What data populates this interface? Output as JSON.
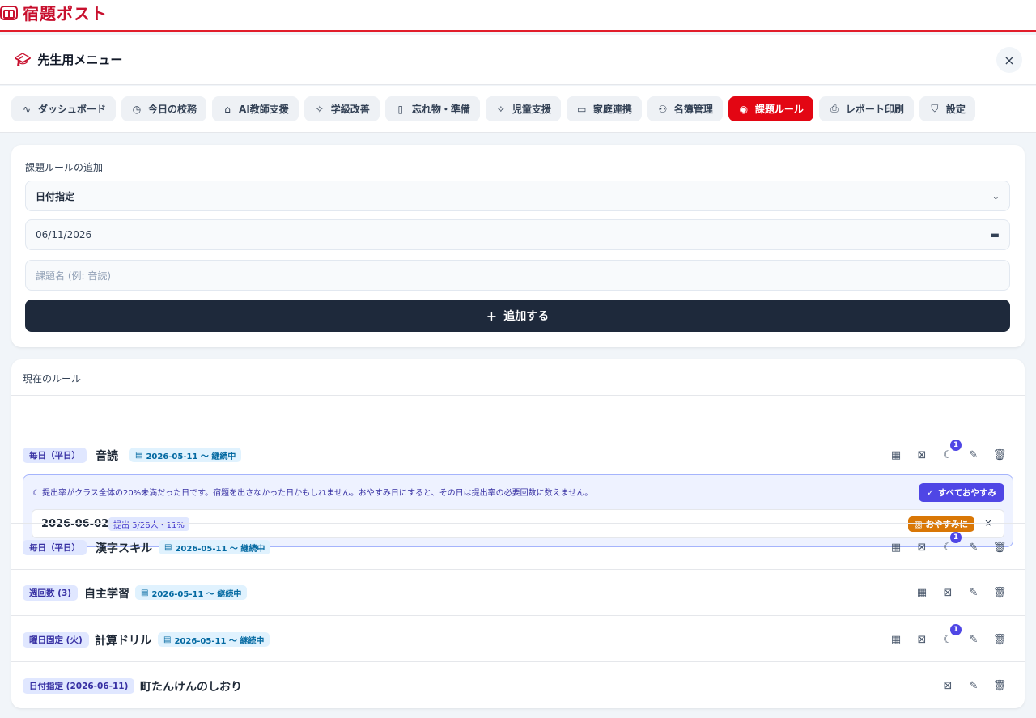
{
  "app": {
    "title": "宿題ポスト",
    "brand_color": "#c8102e"
  },
  "menu": {
    "title": "先生用メニュー",
    "close": "×"
  },
  "tabs": [
    {
      "icon": "activity-icon",
      "glyph": "∿",
      "label": "ダッシュボード"
    },
    {
      "icon": "clock-icon",
      "glyph": "◷",
      "label": "今日の校務"
    },
    {
      "icon": "robot-icon",
      "glyph": "⌂",
      "label": "AI教師支援"
    },
    {
      "icon": "sparkles-icon",
      "glyph": "✧",
      "label": "学級改善"
    },
    {
      "icon": "backpack-icon",
      "glyph": "▯",
      "label": "忘れ物・準備"
    },
    {
      "icon": "handshake-icon",
      "glyph": "⟡",
      "label": "児童支援"
    },
    {
      "icon": "message-icon",
      "glyph": "▭",
      "label": "家庭連携"
    },
    {
      "icon": "users-icon",
      "glyph": "⚇",
      "label": "名簿管理"
    },
    {
      "icon": "check-circle-icon",
      "glyph": "◉",
      "label": "課題ルール",
      "active": true
    },
    {
      "icon": "printer-icon",
      "glyph": "⎙",
      "label": "レポート印刷"
    },
    {
      "icon": "shield-icon",
      "glyph": "⛉",
      "label": "設定"
    }
  ],
  "add_rule": {
    "title": "課題ルールの追加",
    "type_select": "日付指定",
    "date_value": "06/11/2026",
    "name_placeholder": "課題名 (例: 音読)",
    "add_button": "追加する"
  },
  "rules": {
    "title": "現在のルール",
    "items": [
      {
        "type": "毎日（平日）",
        "name": "音読",
        "range": "2026-05-11 〜 継続中",
        "rest_badge": "1"
      },
      {
        "type": "毎日（平日）",
        "name": "漢字スキル",
        "range": "2026-05-11 〜 継続中",
        "rest_badge": "1"
      },
      {
        "type": "週回数 (3)",
        "name": "自主学習",
        "range": "2026-05-11 〜 継続中"
      },
      {
        "type": "曜日固定 (火)",
        "name": "計算ドリル",
        "range": "2026-05-11 〜 継続中",
        "rest_badge": "1"
      },
      {
        "type": "日付指定 (2026-06-11)",
        "name": "町たんけんのしおり"
      }
    ],
    "notice": {
      "message": "提出率がクラス全体の20%未満だった日です。宿題を出さなかった日かもしれません。おやすみ日にすると、その日は提出率の必要回数に数えません。",
      "all_rest_button": "すべておやすみ",
      "date": "2026-06-02",
      "stat": "提出 3/28人・11%",
      "rest_button": "おやすみに",
      "dismiss": "×"
    }
  }
}
